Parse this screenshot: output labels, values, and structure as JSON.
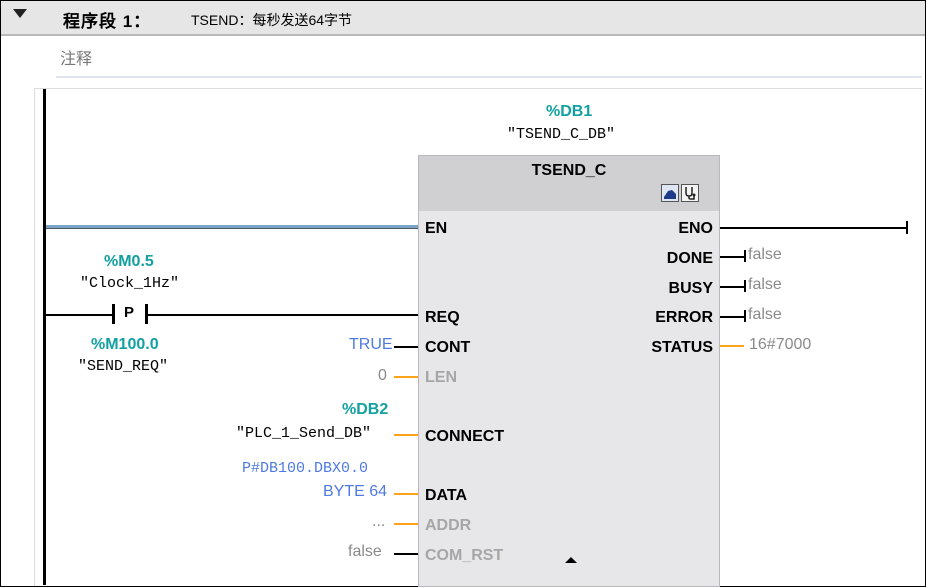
{
  "network": {
    "title": "程序段 1：",
    "name": "TSEND：每秒发送64字节",
    "comment": "注释"
  },
  "instance_db": {
    "address": "%DB1",
    "name": "\"TSEND_C_DB\""
  },
  "block": {
    "title": "TSEND_C",
    "icons": [
      "download-icon",
      "diagnostics-icon"
    ],
    "inputs": {
      "en": "EN",
      "req": "REQ",
      "cont": "CONT",
      "len": "LEN",
      "connect": "CONNECT",
      "data": "DATA",
      "addr": "ADDR",
      "com_rst": "COM_RST"
    },
    "outputs": {
      "eno": "ENO",
      "done": "DONE",
      "busy": "BUSY",
      "error": "ERROR",
      "status": "STATUS"
    }
  },
  "req_contact": {
    "address": "%M0.5",
    "tag": "\"Clock_1Hz\"",
    "type": "P",
    "edge_address": "%M100.0",
    "edge_tag": "\"SEND_REQ\""
  },
  "params": {
    "cont": "TRUE",
    "len": "0",
    "connect_address": "%DB2",
    "connect_tag": "\"PLC_1_Send_DB\"",
    "data_pointer": "P#DB100.DBX0.0",
    "data_type": "BYTE 64",
    "addr": "...",
    "com_rst": "false"
  },
  "outputs_values": {
    "done": "false",
    "busy": "false",
    "error": "false",
    "status": "16#7000"
  },
  "colors": {
    "operand_address": "#12a0a0",
    "constant": "#4f7ae0",
    "wire_orange": "#ffa31a",
    "header_bg": "#e6e6e6",
    "block_bg": "#e7e7e9"
  }
}
